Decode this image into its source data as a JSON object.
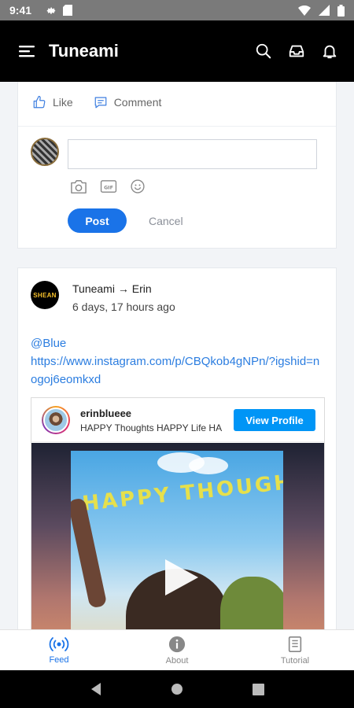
{
  "status_bar": {
    "time": "9:41"
  },
  "app": {
    "title": "Tuneami"
  },
  "reply_card": {
    "like_label": "Like",
    "comment_label": "Comment",
    "input_placeholder": "",
    "post_label": "Post",
    "cancel_label": "Cancel"
  },
  "post": {
    "avatar_text": "SHEAN",
    "author_line": "Tuneami → Erin",
    "time_ago": "6 days, 17 hours ago",
    "mention": "@Blue",
    "link": "https://www.instagram.com/p/CBQkob4gNPn/?igshid=nogoj6eomkxd",
    "embed": {
      "username": "erinblueee",
      "bio": "HAPPY Thoughts HAPPY Life HA",
      "view_profile_label": "View Profile",
      "image_text": "HAPPY THOUGHTS"
    }
  },
  "bottom_nav": {
    "tabs": [
      {
        "label": "Feed",
        "active": true
      },
      {
        "label": "About",
        "active": false
      },
      {
        "label": "Tutorial",
        "active": false
      }
    ]
  },
  "colors": {
    "accent": "#1a73e8",
    "instagram_blue": "#0095f6",
    "link": "#2b7de0"
  }
}
